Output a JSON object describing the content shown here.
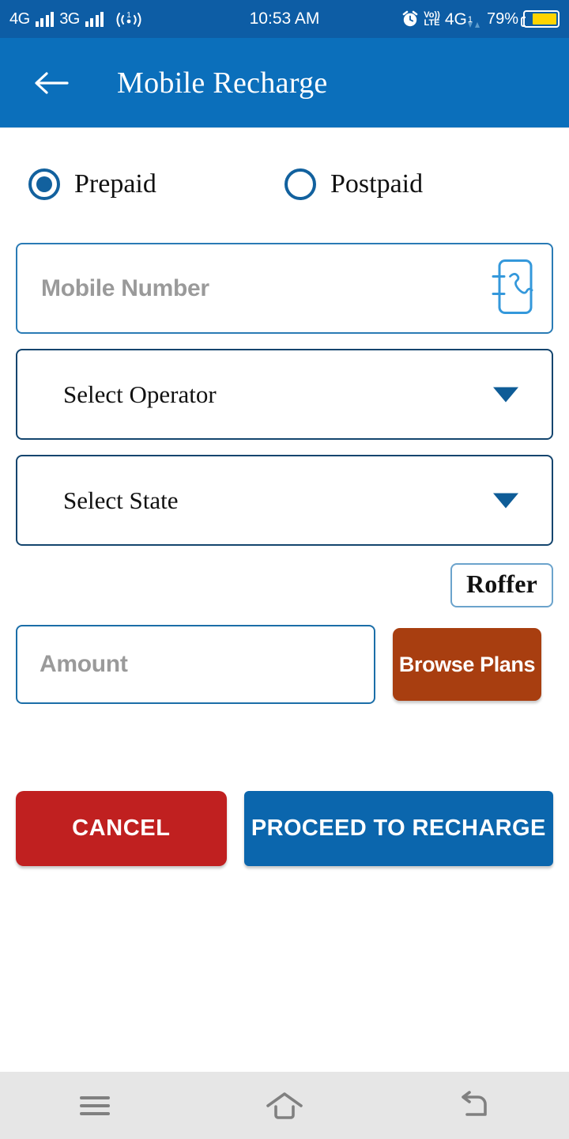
{
  "status_bar": {
    "sim1_network": "4G",
    "sim2_network": "3G",
    "hotspot_badge": "1",
    "time": "10:53 AM",
    "volte_top": "Vo))",
    "volte_bottom": "LTE",
    "data_network": "4G",
    "data_network_sub": "1",
    "battery_percent": "79%",
    "battery_level": 79,
    "bg_color": "#0d5da5"
  },
  "app_bar": {
    "title": "Mobile Recharge",
    "back_icon": "arrow-left-icon",
    "bg_color": "#0b6fbb"
  },
  "connection_type": {
    "options": [
      {
        "label": "Prepaid",
        "selected": true
      },
      {
        "label": "Postpaid",
        "selected": false
      }
    ],
    "accent_color": "#12619e"
  },
  "form": {
    "mobile_number": {
      "placeholder": "Mobile Number",
      "value": "",
      "trailing_icon": "contact-book-icon"
    },
    "operator": {
      "label": "Select Operator",
      "value": "",
      "caret_icon": "chevron-down-icon"
    },
    "state": {
      "label": "Select State",
      "value": "",
      "caret_icon": "chevron-down-icon"
    },
    "roffer_label": "Roffer",
    "amount": {
      "placeholder": "Amount",
      "value": ""
    },
    "browse_plans_label": "Browse Plans",
    "browse_plans_color": "#a83e10"
  },
  "actions": {
    "cancel_label": "CANCEL",
    "cancel_color": "#c02020",
    "proceed_label": "PROCEED TO RECHARGE",
    "proceed_color": "#0b66ad"
  },
  "nav_bar": {
    "menu_icon": "menu-icon",
    "home_icon": "home-icon",
    "back_icon": "back-arrow-icon",
    "bg_color": "#e6e6e6"
  }
}
